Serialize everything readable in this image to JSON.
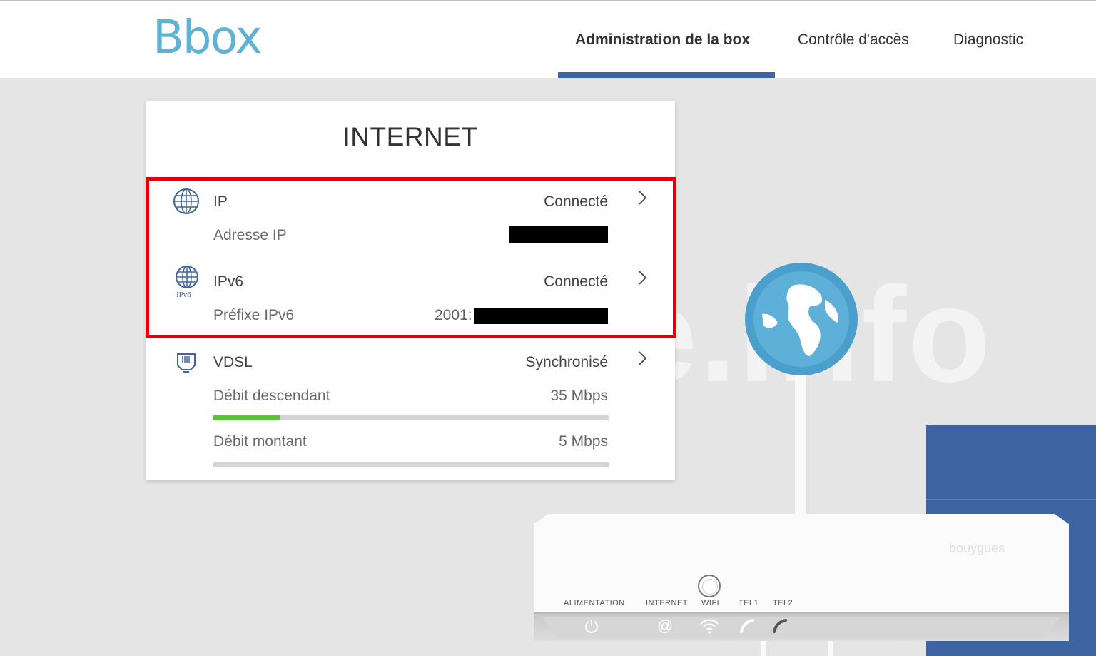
{
  "header": {
    "logo": "Bbox",
    "nav": [
      {
        "label": "Administration de la box",
        "active": true
      },
      {
        "label": "Contrôle d'accès",
        "active": false
      },
      {
        "label": "Diagnostic",
        "active": false
      }
    ]
  },
  "watermark": "lecrabe.info",
  "card": {
    "title": "INTERNET",
    "ip": {
      "title": "IP",
      "status": "Connecté",
      "label": "Adresse IP"
    },
    "ipv6": {
      "title": "IPv6",
      "icon_caption": "IPv6",
      "status": "Connecté",
      "label": "Préfixe IPv6",
      "value_prefix": "2001:"
    },
    "vdsl": {
      "title": "VDSL",
      "status": "Synchronisé",
      "down_label": "Débit descendant",
      "down_value": "35 Mbps",
      "down_fill": 0.168,
      "up_label": "Débit montant",
      "up_value": "5 Mbps",
      "up_fill": 0
    }
  },
  "router": {
    "brand": "bouygues",
    "leds": [
      "ALIMENTATION",
      "INTERNET",
      "WIFI",
      "TEL1",
      "TEL2"
    ]
  },
  "colors": {
    "accent": "#3e64a3",
    "logo": "#5fb2d3",
    "highlight": "#e0000c",
    "progress": "#59c13a"
  }
}
